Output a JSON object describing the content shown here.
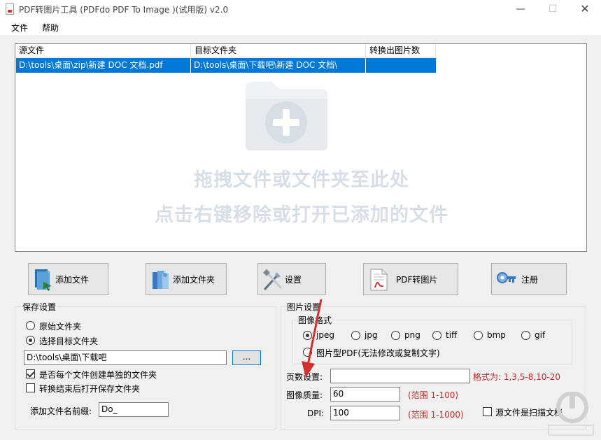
{
  "window": {
    "title": "PDF转图片工具 (PDFdo PDF To Image )(试用版) v2.0"
  },
  "menu": [
    "文件",
    "帮助"
  ],
  "file_list": {
    "columns": [
      "源文件",
      "目标文件夹",
      "转换出图片数"
    ],
    "rows": [
      {
        "source": "D:\\tools\\桌面\\zip\\新建 DOC 文档.pdf",
        "target": "D:\\tools\\桌面\\下载吧\\新建 DOC 文档\\",
        "count": ""
      }
    ],
    "hint_line1": "拖拽文件或文件夹至此处",
    "hint_line2": "点击右键移除或打开已添加的文件"
  },
  "toolbar": {
    "add_file": "添加文件",
    "add_folder": "添加文件夹",
    "settings": "设置",
    "convert": "PDF转图片",
    "register": "注册"
  },
  "save_settings": {
    "title": "保存设置",
    "opt_original": "原始文件夹",
    "opt_target": "选择目标文件夹",
    "target_path": "D:\\tools\\桌面\\下载吧",
    "browse_label": "...",
    "create_folder_label": "是否每个文件创建单独的文件夹",
    "create_folder_checked": true,
    "open_after_label": "转换结束后打开保存文件夹",
    "open_after_checked": false,
    "prefix_label": "添加文件名前缀:",
    "prefix_value": "Do_"
  },
  "image_settings": {
    "title": "图片设置",
    "format_title": "图像格式",
    "formats": [
      "jpeg",
      "jpg",
      "png",
      "tiff",
      "bmp",
      "gif"
    ],
    "selected_format": "jpeg",
    "pdf_image_label": "图片型PDF(无法修改或复制文字)",
    "pages_label": "页数设置:",
    "pages_value": "",
    "pages_hint": "格式为: 1,3,5-8,10-20",
    "quality_label": "图像质量:",
    "quality_value": "60",
    "quality_hint": "(范围 1-100)",
    "dpi_label": "DPI:",
    "dpi_value": "100",
    "dpi_hint": "(范围 1-1000)",
    "scanned_label": "源文件是扫描文档"
  },
  "colors": {
    "selection": "#0078d7",
    "hint": "#c62828",
    "arrow": "#d32f2f"
  }
}
